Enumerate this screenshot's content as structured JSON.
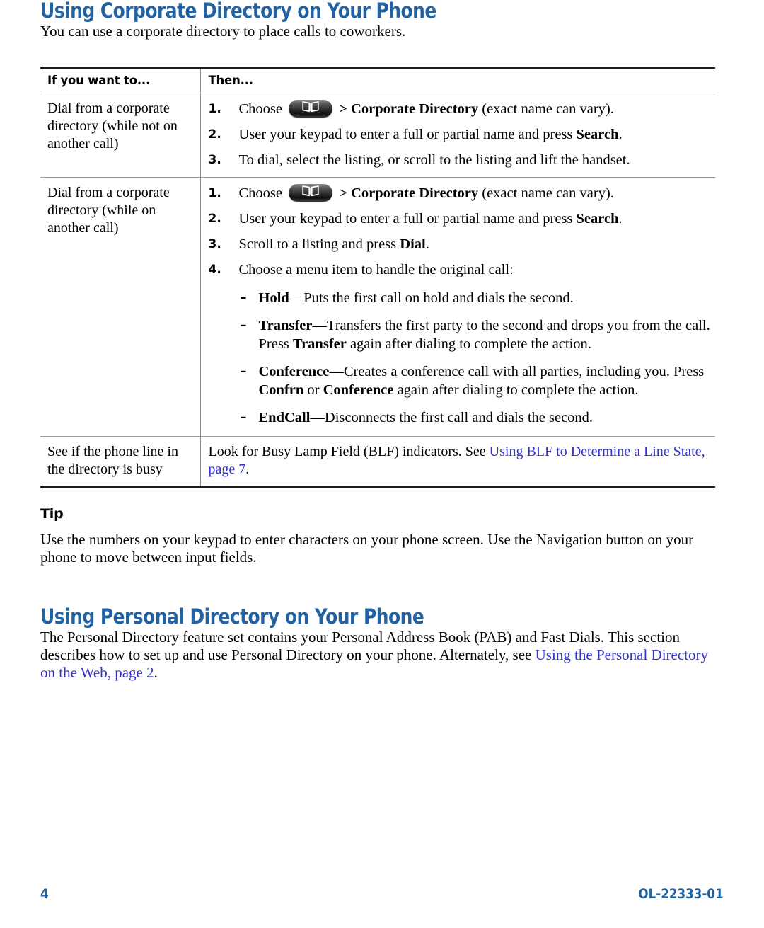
{
  "document": {
    "page_number": "4",
    "doc_id": "OL-22333-01"
  },
  "sections": [
    {
      "heading": "Using Corporate Directory on Your Phone",
      "intro": "You can use a corporate directory to place calls to coworkers."
    },
    {
      "heading": "Using Personal Directory on Your Phone",
      "intro_part1": "The Personal Directory feature set contains your Personal Address Book (PAB) and Fast Dials. This section describes how to set up and use Personal Directory on your phone. Alternately, see ",
      "intro_link": "Using the Personal Directory on the Web, page 2",
      "intro_part2": "."
    }
  ],
  "table": {
    "headers": {
      "col1": "If you want to...",
      "col2": "Then..."
    },
    "rows": [
      {
        "condition": "Dial from a corporate directory (while not on another call)",
        "steps": [
          {
            "num": "1.",
            "pre": "Choose",
            "icon": "directory-book-icon",
            "sep": ">",
            "bold": "Corporate Directory",
            "post": "(exact name can vary)."
          },
          {
            "num": "2.",
            "pre": "User your keypad to enter a full or partial name and press",
            "bold": "Search",
            "post": "."
          },
          {
            "num": "3.",
            "pre": "To dial, select the listing, or scroll to the listing and lift the handset."
          }
        ]
      },
      {
        "condition": "Dial from a corporate directory (while on another call)",
        "steps": [
          {
            "num": "1.",
            "pre": "Choose",
            "icon": "directory-book-icon",
            "sep": ">",
            "bold": "Corporate Directory",
            "post": "(exact name can vary)."
          },
          {
            "num": "2.",
            "pre": "User your keypad to enter a full or partial name and press",
            "bold": "Search",
            "post": "."
          },
          {
            "num": "3.",
            "pre": "Scroll to a listing and press",
            "bold": "Dial",
            "post": "."
          },
          {
            "num": "4.",
            "pre": "Choose a menu item to handle the original call:"
          }
        ],
        "subitems": [
          {
            "dash": "–",
            "term": "Hold",
            "text": "—Puts the first call on hold and dials the second."
          },
          {
            "dash": "–",
            "term": "Transfer",
            "text_a": "—Transfers the first party to the second and drops you from the call. Press ",
            "term_b": "Transfer",
            "text_b": " again after dialing to complete the action."
          },
          {
            "dash": "–",
            "term": "Conference",
            "text_a": "—Creates a conference call with all parties, including you. Press ",
            "term_b": "Confrn",
            "text_mid": " or ",
            "term_c": "Conference",
            "text_b": " again after dialing to complete the action."
          },
          {
            "dash": "–",
            "term": "EndCall",
            "text": "—Disconnects the first call and dials the second."
          }
        ]
      },
      {
        "condition": "See if the phone line in the directory is busy",
        "plain_pre": "Look for Busy Lamp Field (BLF) indicators. See ",
        "link": "Using BLF to Determine a Line State, page 7",
        "plain_post": "."
      }
    ]
  },
  "tip": {
    "heading": "Tip",
    "body": "Use the numbers on your keypad to enter characters on your phone screen. Use the Navigation button on your phone to move between input fields."
  },
  "colors": {
    "heading_blue": "#2262a0",
    "link_blue": "#3232cc",
    "rule_dark": "#1a1a1a",
    "rule_light": "#9a9a9a"
  }
}
